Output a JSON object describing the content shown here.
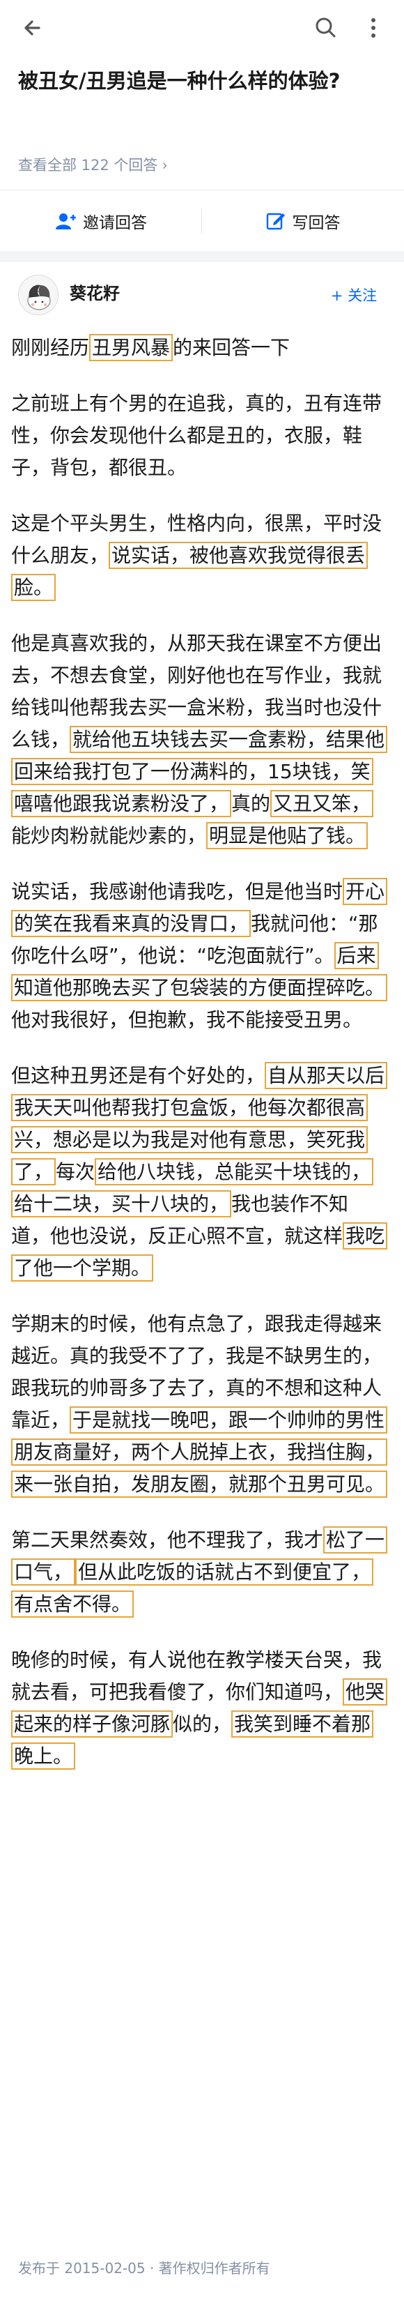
{
  "question": {
    "title": "被丑女/丑男追是一种什么样的体验?",
    "view_all": "查看全部 122 个回答"
  },
  "actions": {
    "invite": "邀请回答",
    "write": "写回答"
  },
  "author": {
    "name": "葵花籽",
    "follow": "+ 关注"
  },
  "paragraphs": [
    [
      {
        "t": "刚刚经历"
      },
      {
        "t": "丑男风暴",
        "hl": true
      },
      {
        "t": "的来回答一下"
      }
    ],
    [
      {
        "t": "之前班上有个男的在追我，真的，丑有连带性，你会发现他什么都是丑的，衣服，鞋子，背包，都很丑。"
      }
    ],
    [
      {
        "t": "这是个平头男生，性格内向，很黑，平时没什么朋友，"
      },
      {
        "t": "说实话，被他喜欢我觉得很丢脸。",
        "hl": true
      }
    ],
    [
      {
        "t": "他是真喜欢我的，从那天我在课室不方便出去，不想去食堂，刚好他也在写作业，我就给钱叫他帮我去买一盒米粉，我当时也没什么钱，"
      },
      {
        "t": "就给他五块钱去买一盒素粉，结果他回来给我打包了一份满料的，15块钱，笑嘻嘻他跟我说素粉没了，",
        "hl": true
      },
      {
        "t": "真的"
      },
      {
        "t": "又丑又笨，",
        "hl": true
      },
      {
        "t": "能炒肉粉就能炒素的，"
      },
      {
        "t": "明显是他贴了钱。",
        "hl": true
      }
    ],
    [
      {
        "t": "说实话，我感谢他请我吃，但是他当时"
      },
      {
        "t": "开心的笑在我看来真的没胃口，",
        "hl": true
      },
      {
        "t": "我就问他：“那你吃什么呀”，他说：“吃泡面就行”。"
      },
      {
        "t": "后来知道他那晚去买了包袋装的方便面捏碎吃。",
        "hl": true
      },
      {
        "t": "他对我很好，但抱歉，我不能接受丑男。"
      }
    ],
    [
      {
        "t": "但这种丑男还是有个好处的，"
      },
      {
        "t": "自从那天以后我天天叫他帮我打包盒饭，他每次都很高兴，想必是以为我是对他有意思，笑死我了，",
        "hl": true
      },
      {
        "t": "每次"
      },
      {
        "t": "给他八块钱，总能买十块钱的，给十二块，买十八块的，",
        "hl": true
      },
      {
        "t": "我也装作不知道，他也没说，反正心照不宣，就这样"
      },
      {
        "t": "我吃了他一个学期。",
        "hl": true
      }
    ],
    [
      {
        "t": "学期末的时候，他有点急了，跟我走得越来越近。真的我受不了了，我是不缺男生的，跟我玩的帅哥多了去了，真的不想和这种人靠近，"
      },
      {
        "t": "于是就找一晚吧，跟一个帅帅的男性朋友商量好，两个人脱掉上衣，我挡住胸，来一张自拍，发朋友圈，就那个丑男可见。",
        "hl": true
      }
    ],
    [
      {
        "t": "第二天果然奏效，他不理我了，我才"
      },
      {
        "t": "松了一口气，",
        "hl": true
      },
      {
        "t": "但从此吃饭的话就占不到便宜了，有点舍不得。",
        "hl": true
      }
    ],
    [
      {
        "t": "晚修的时候，有人说他在教学楼天台哭，我就去看，可把我看傻了，你们知道吗，"
      },
      {
        "t": "他哭起来的样子像河豚",
        "hl": true
      },
      {
        "t": "似的，"
      },
      {
        "t": "我笑到睡不着那晚上。",
        "hl": true
      }
    ]
  ],
  "footer": "发布于 2015-02-05 · 著作权归作者所有",
  "colors": {
    "highlight_border": "#e8a53c",
    "accent": "#0066ff",
    "muted": "#8590a6"
  },
  "icons": [
    "back-arrow-icon",
    "search-icon",
    "more-icon",
    "invite-icon",
    "edit-icon",
    "chevron-right-icon"
  ]
}
